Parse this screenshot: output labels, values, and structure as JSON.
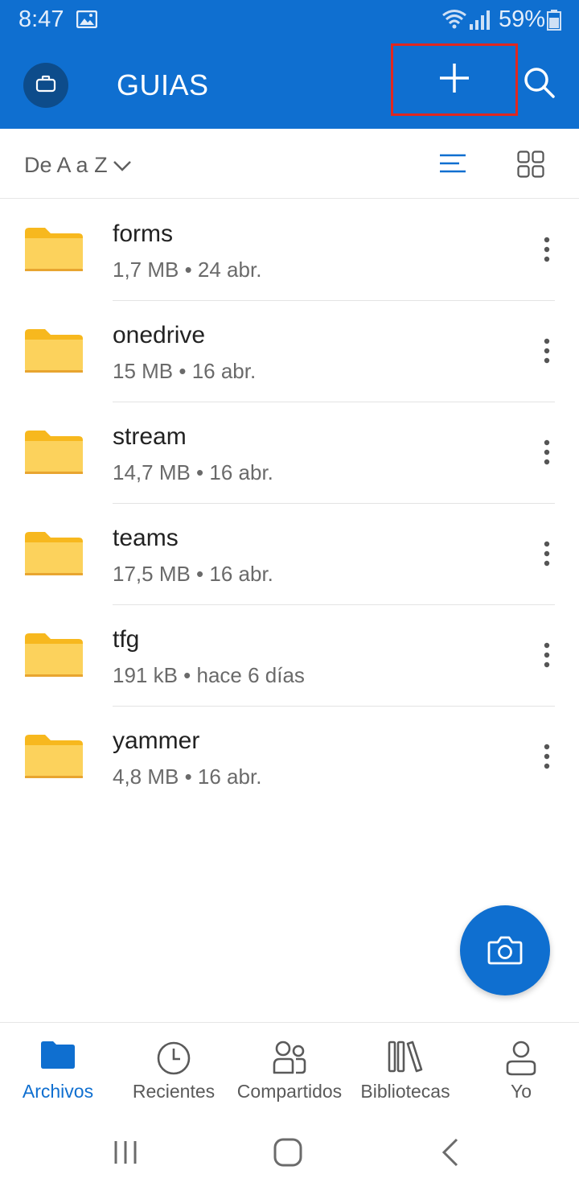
{
  "status_bar": {
    "time": "8:47",
    "battery": "59%",
    "icons": [
      "gallery-icon",
      "wifi-icon",
      "signal-icon",
      "battery-icon"
    ]
  },
  "app_bar": {
    "title": "GUIAS",
    "icons": [
      "briefcase-icon",
      "plus-icon",
      "search-icon"
    ]
  },
  "sort": {
    "label": "De A a Z"
  },
  "files": [
    {
      "name": "forms",
      "meta": "1,7 MB • 24 abr."
    },
    {
      "name": "onedrive",
      "meta": "15 MB • 16 abr."
    },
    {
      "name": "stream",
      "meta": "14,7 MB • 16 abr."
    },
    {
      "name": "teams",
      "meta": "17,5 MB • 16 abr."
    },
    {
      "name": "tfg",
      "meta": "191 kB • hace 6 días"
    },
    {
      "name": "yammer",
      "meta": "4,8 MB • 16 abr."
    }
  ],
  "bottom_nav": {
    "items": [
      {
        "label": "Archivos",
        "icon": "folder-icon",
        "active": true
      },
      {
        "label": "Recientes",
        "icon": "clock-icon",
        "active": false
      },
      {
        "label": "Compartidos",
        "icon": "people-icon",
        "active": false
      },
      {
        "label": "Bibliotecas",
        "icon": "library-icon",
        "active": false
      },
      {
        "label": "Yo",
        "icon": "person-icon",
        "active": false
      }
    ]
  },
  "colors": {
    "brand": "#0f6fd0",
    "highlight_box": "#e0271f",
    "folder": "#fcd25c"
  }
}
